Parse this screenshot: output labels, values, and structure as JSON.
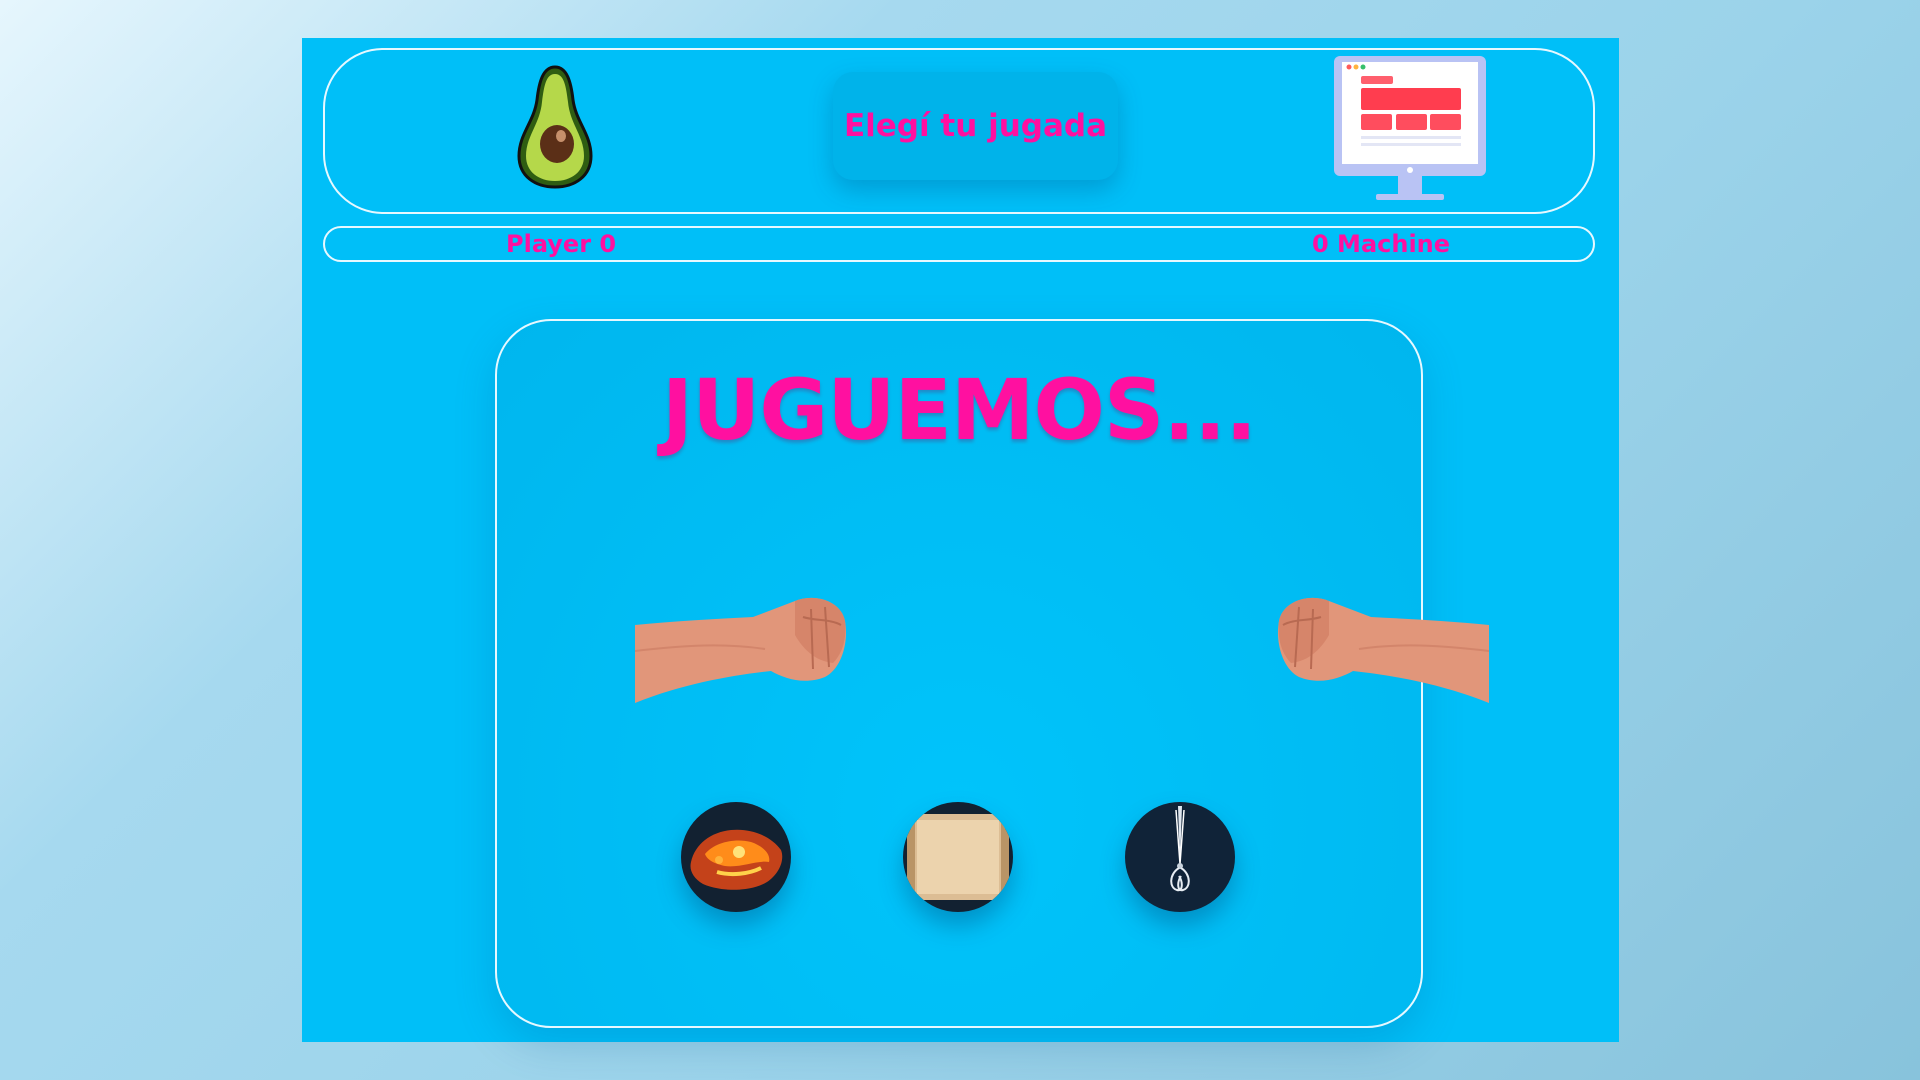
{
  "header": {
    "player_avatar_icon": "avocado-icon",
    "prompt": "Elegí tu jugada",
    "machine_avatar_icon": "computer-monitor-icon"
  },
  "scoreboard": {
    "player_label": "Player 0",
    "machine_label": "0 Machine"
  },
  "board": {
    "title": "JUGUEMOS...",
    "left_hand_icon": "fist-icon",
    "right_hand_icon": "fist-icon",
    "choices": [
      {
        "name": "rock",
        "icon": "rock-icon"
      },
      {
        "name": "paper",
        "icon": "paper-icon"
      },
      {
        "name": "scissors",
        "icon": "scissors-icon"
      }
    ]
  },
  "colors": {
    "background": "#00bff8",
    "accent": "#ff10a0",
    "outline": "#e6f8ff"
  }
}
